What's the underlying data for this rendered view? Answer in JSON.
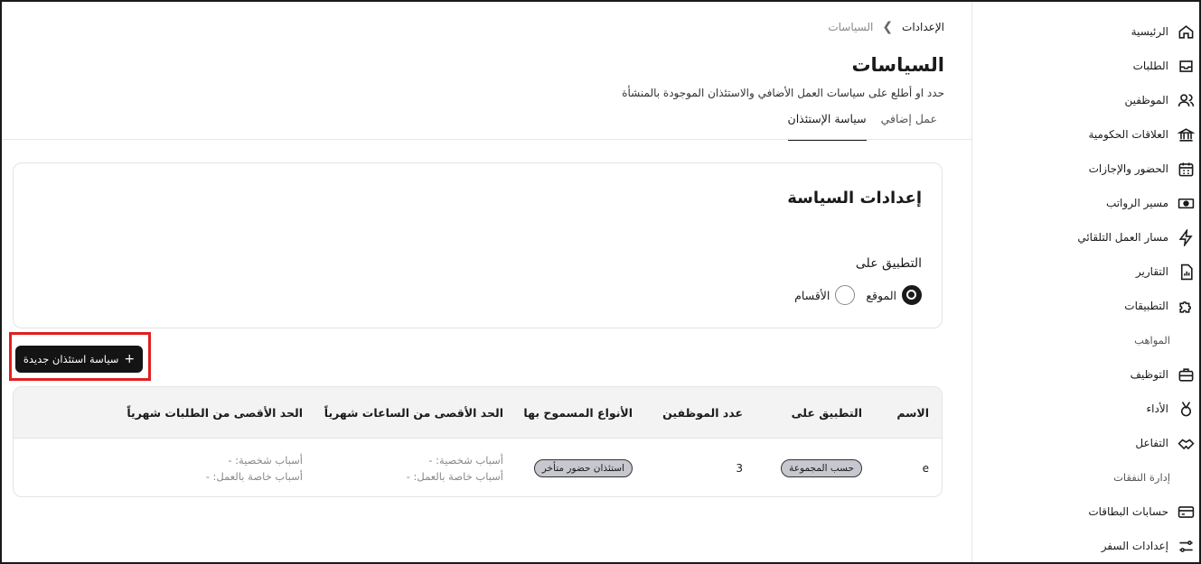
{
  "breadcrumb": {
    "root": "الإعدادات",
    "current": "السياسات"
  },
  "page": {
    "title": "السياسات",
    "subtitle": "حدد او أطلع على سياسات العمل الأضافي والاستئذان الموجودة بالمنشأة"
  },
  "tabs": [
    {
      "label": "عمل إضافي",
      "active": false
    },
    {
      "label": "سياسة الإستئذان",
      "active": true
    }
  ],
  "settings": {
    "title": "إعدادات السياسة",
    "apply_label": "التطبيق على",
    "options": [
      {
        "label": "الموقع",
        "selected": true
      },
      {
        "label": "الأقسام",
        "selected": false
      }
    ]
  },
  "new_policy_button": {
    "label": "سياسة استئذان جديدة",
    "icon": "plus-icon"
  },
  "table": {
    "headers": [
      "الاسم",
      "التطبيق على",
      "عدد الموظفين",
      "الأنواع المسموح بها",
      "الحد الأقصى من الساعات شهرياً",
      "الحد الأقصى من الطلبات شهرياً"
    ],
    "rows": [
      {
        "name": "e",
        "applies_to": "حسب المجموعة",
        "employees": "3",
        "allowed_type": "استئذان حضور متأخر",
        "hours_personal": "أسباب شخصية: -",
        "hours_work": "أسباب خاصة بالعمل: -",
        "requests_personal": "أسباب شخصية: -",
        "requests_work": "أسباب خاصة بالعمل: -"
      }
    ]
  },
  "sidebar": {
    "items": [
      {
        "label": "الرئيسية",
        "icon": "home-icon"
      },
      {
        "label": "الطلبات",
        "icon": "inbox-icon"
      },
      {
        "label": "الموظفين",
        "icon": "users-icon"
      },
      {
        "label": "العلاقات الحكومية",
        "icon": "bank-icon"
      },
      {
        "label": "الحضور والإجازات",
        "icon": "calendar-icon"
      },
      {
        "label": "مسير الرواتب",
        "icon": "money-icon"
      },
      {
        "label": "مسار العمل التلقائي",
        "icon": "automation-icon"
      },
      {
        "label": "التقارير",
        "icon": "report-icon"
      },
      {
        "label": "التطبيقات",
        "icon": "puzzle-icon"
      }
    ],
    "section_talent": "المواهب",
    "talent_items": [
      {
        "label": "التوظيف",
        "icon": "briefcase-icon"
      },
      {
        "label": "الأداء",
        "icon": "medal-icon"
      },
      {
        "label": "التفاعل",
        "icon": "handshake-icon"
      }
    ],
    "section_expenses": "إدارة النفقات",
    "expense_items": [
      {
        "label": "حسابات البطاقات",
        "icon": "card-icon"
      },
      {
        "label": "إعدادات السفر",
        "icon": "sliders-icon"
      }
    ]
  }
}
